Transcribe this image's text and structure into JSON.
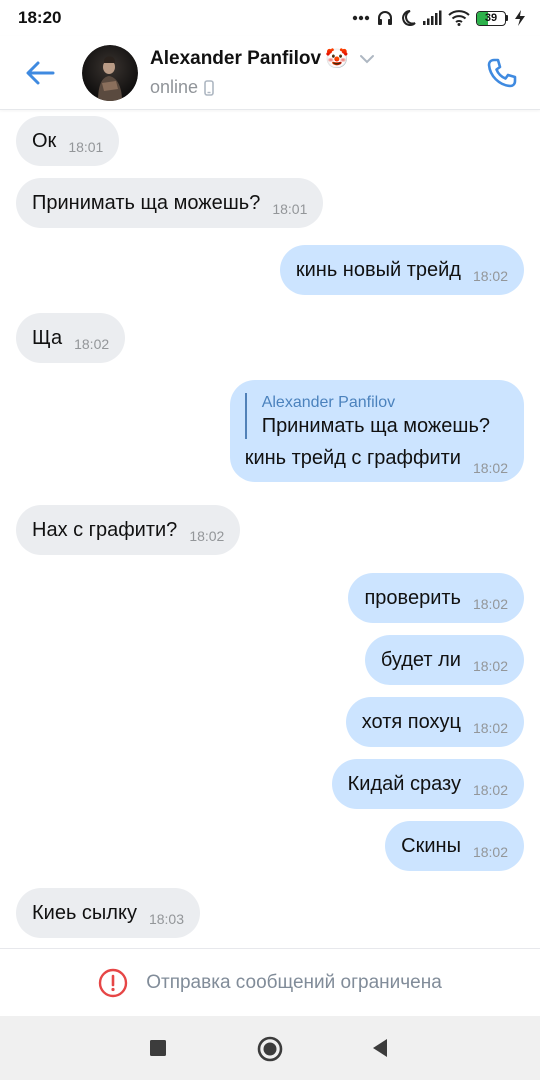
{
  "status_bar": {
    "time": "18:20",
    "battery_level": "39",
    "icons": [
      "dots-icon",
      "headphones-icon",
      "moon-icon",
      "signal-icon",
      "wifi-icon",
      "battery-icon",
      "charging-icon"
    ]
  },
  "header": {
    "contact_name": "Alexander Panfilov",
    "name_emoji": "🤡",
    "presence": "online",
    "accent_color": "#3f8ae0"
  },
  "messages": [
    {
      "direction": "in",
      "text": "Ок",
      "time": "18:01"
    },
    {
      "direction": "in",
      "text": "Принимать ща можешь?",
      "time": "18:01"
    },
    {
      "direction": "out",
      "text": "кинь новый трейд",
      "time": "18:02"
    },
    {
      "direction": "in",
      "text": "Ща",
      "time": "18:02"
    },
    {
      "direction": "out",
      "reply_author": "Alexander Panfilov",
      "reply_text": "Принимать ща можешь?",
      "text": "кинь трейд с граффити",
      "time": "18:02"
    },
    {
      "direction": "in",
      "text": "Нах с графити?",
      "time": "18:02"
    },
    {
      "direction": "out",
      "text": "проверить",
      "time": "18:02"
    },
    {
      "direction": "out",
      "text": "будет ли",
      "time": "18:02"
    },
    {
      "direction": "out",
      "text": "хотя похуц",
      "time": "18:02"
    },
    {
      "direction": "out",
      "text": "Кидай сразу",
      "time": "18:02"
    },
    {
      "direction": "out",
      "text": "Скины",
      "time": "18:02"
    },
    {
      "direction": "in",
      "text": "Киеь сылку",
      "time": "18:03"
    }
  ],
  "restriction": {
    "text": "Отправка сообщений ограничена",
    "icon": "alert-circle-icon",
    "color": "#e64646"
  },
  "colors": {
    "incoming_bubble": "#ebedf0",
    "outgoing_bubble": "#cce4ff",
    "quote_author": "#4b82bd"
  }
}
